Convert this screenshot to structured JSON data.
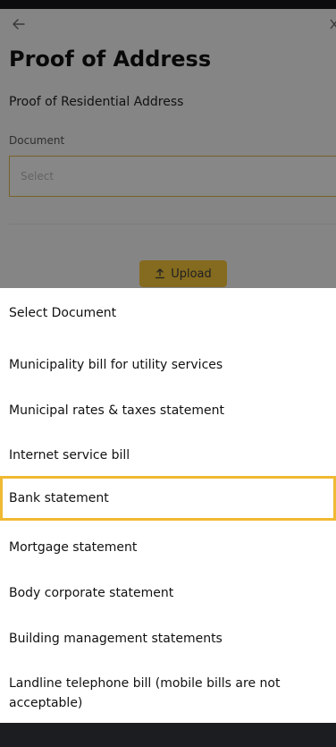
{
  "page": {
    "title": "Proof of Address",
    "subtitle": "Proof of Residential Address",
    "field_label": "Document",
    "select_placeholder": "Select",
    "upload_label": "Upload"
  },
  "sheet": {
    "header": "Select Document",
    "options": [
      "Municipality bill for utility services",
      "Municipal rates & taxes statement",
      "Internet service bill",
      "Bank statement",
      "Mortgage statement",
      "Body corporate statement",
      "Building management statements",
      "Landline telephone bill (mobile bills are not acceptable)"
    ],
    "selected_index": 3
  },
  "colors": {
    "accent": "#f2c33a",
    "selection_outline": "#f0b933"
  },
  "icons": {
    "back": "back-arrow-icon",
    "close": "close-icon",
    "upload": "upload-icon",
    "caret": "chevron-down-icon"
  }
}
